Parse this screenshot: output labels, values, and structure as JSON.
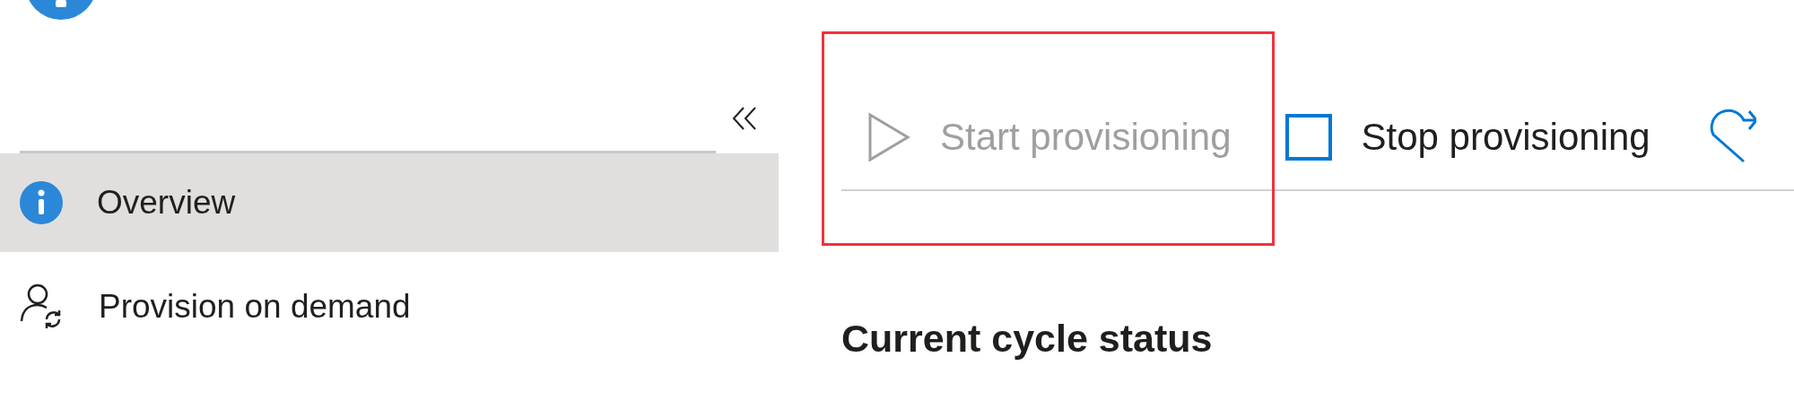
{
  "sidebar": {
    "items": [
      {
        "label": "Overview",
        "kind": "info",
        "selected": true
      },
      {
        "label": "Provision on demand",
        "kind": "person-sync",
        "selected": false
      }
    ]
  },
  "toolbar": [
    {
      "label": "Start provisioning",
      "kind": "play",
      "disabled": true,
      "highlighted": true
    },
    {
      "label": "Stop provisioning",
      "kind": "stop",
      "disabled": false,
      "highlighted": false
    },
    {
      "kind": "refresh",
      "disabled": false,
      "highlighted": false
    }
  ],
  "section": {
    "heading": "Current cycle status"
  }
}
